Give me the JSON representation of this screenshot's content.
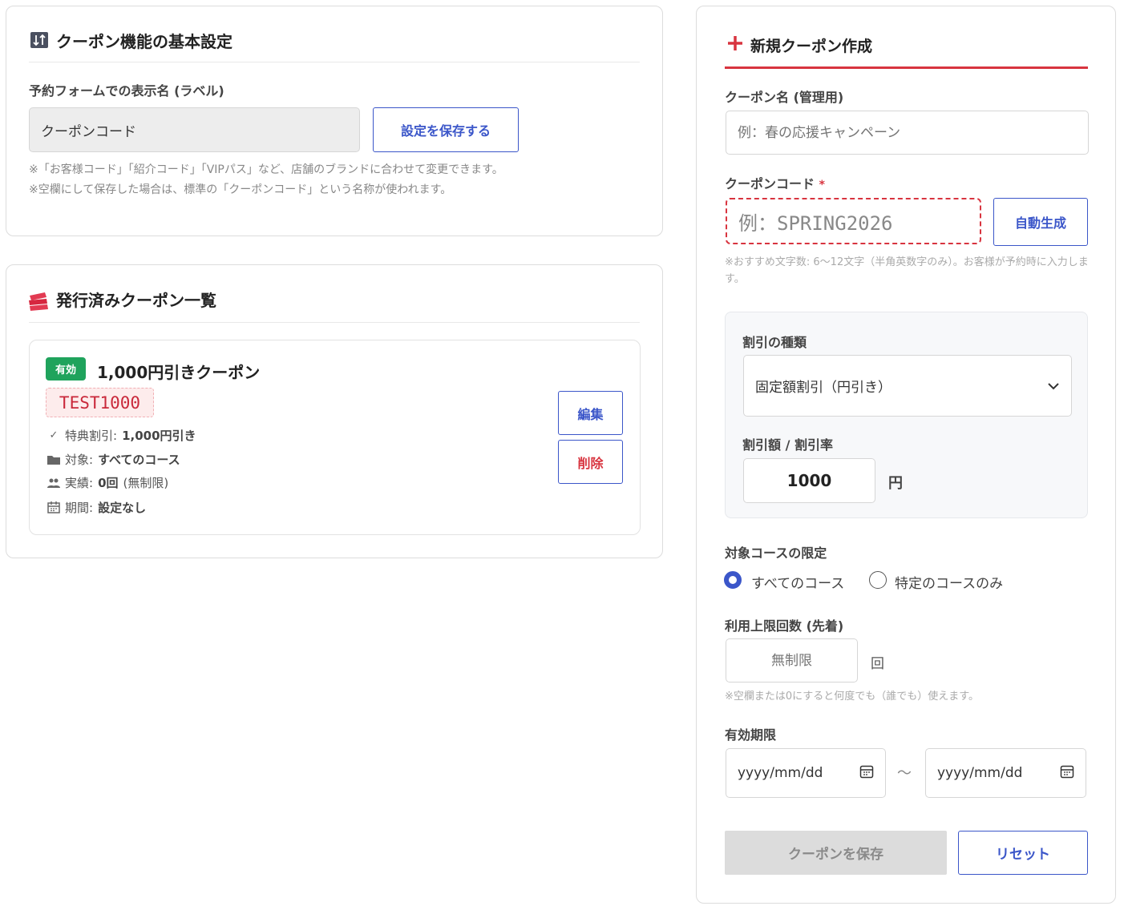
{
  "settings": {
    "title": "クーポン機能の基本設定",
    "icon": "sort-settings-icon",
    "label_field_label": "予約フォームでの表示名 (ラベル)",
    "label_value": "クーポンコード",
    "save_button": "設定を保存する",
    "note1": "※「お客様コード」「紹介コード」「VIPパス」など、店舗のブランドに合わせて変更できます。",
    "note2": "※空欄にして保存した場合は、標準の「クーポンコード」という名称が使われます。"
  },
  "list": {
    "title": "発行済みクーポン一覧",
    "icon": "tickets-icon",
    "coupons": [
      {
        "status": "有効",
        "name": "1,000円引きクーポン",
        "code": "TEST1000",
        "benefit_label": "特典割引:",
        "benefit_value": "1,000円引き",
        "target_label": "対象:",
        "target_value": "すべてのコース",
        "usage_label": "実績:",
        "usage_value": "0回",
        "usage_extra": "(無制限)",
        "period_label": "期間:",
        "period_value": "設定なし",
        "edit_button": "編集",
        "delete_button": "削除"
      }
    ]
  },
  "form": {
    "title": "新規クーポン作成",
    "title_icon": "plus-icon",
    "name_label": "クーポン名 (管理用)",
    "name_placeholder": "例：春の応援キャンペーン",
    "code_label": "クーポンコード",
    "required_mark": "*",
    "code_placeholder": "例：SPRING2026",
    "autogen_button": "自動生成",
    "code_note": "※おすすめ文字数: 6〜12文字（半角英数字のみ）。お客様が予約時に入力します。",
    "discount_type_label": "割引の種類",
    "discount_type_value": "固定額割引（円引き）",
    "discount_amount_label": "割引額 / 割引率",
    "discount_amount_value": "1000",
    "discount_unit": "円",
    "target_label": "対象コースの限定",
    "target_options": [
      "すべてのコース",
      "特定のコースのみ"
    ],
    "target_selected": 0,
    "limit_label": "利用上限回数 (先着)",
    "limit_placeholder": "無制限",
    "limit_unit": "回",
    "limit_note": "※空欄または0にすると何度でも（誰でも）使えます。",
    "period_label": "有効期限",
    "date_placeholder": "yyyy/mm/dd",
    "tilde": "〜",
    "save_button": "クーポンを保存",
    "reset_button": "リセット"
  },
  "colors": {
    "accent": "#3b56c9",
    "danger": "#d8343f",
    "success": "#1fa35c",
    "code_bg": "#fdecec"
  }
}
